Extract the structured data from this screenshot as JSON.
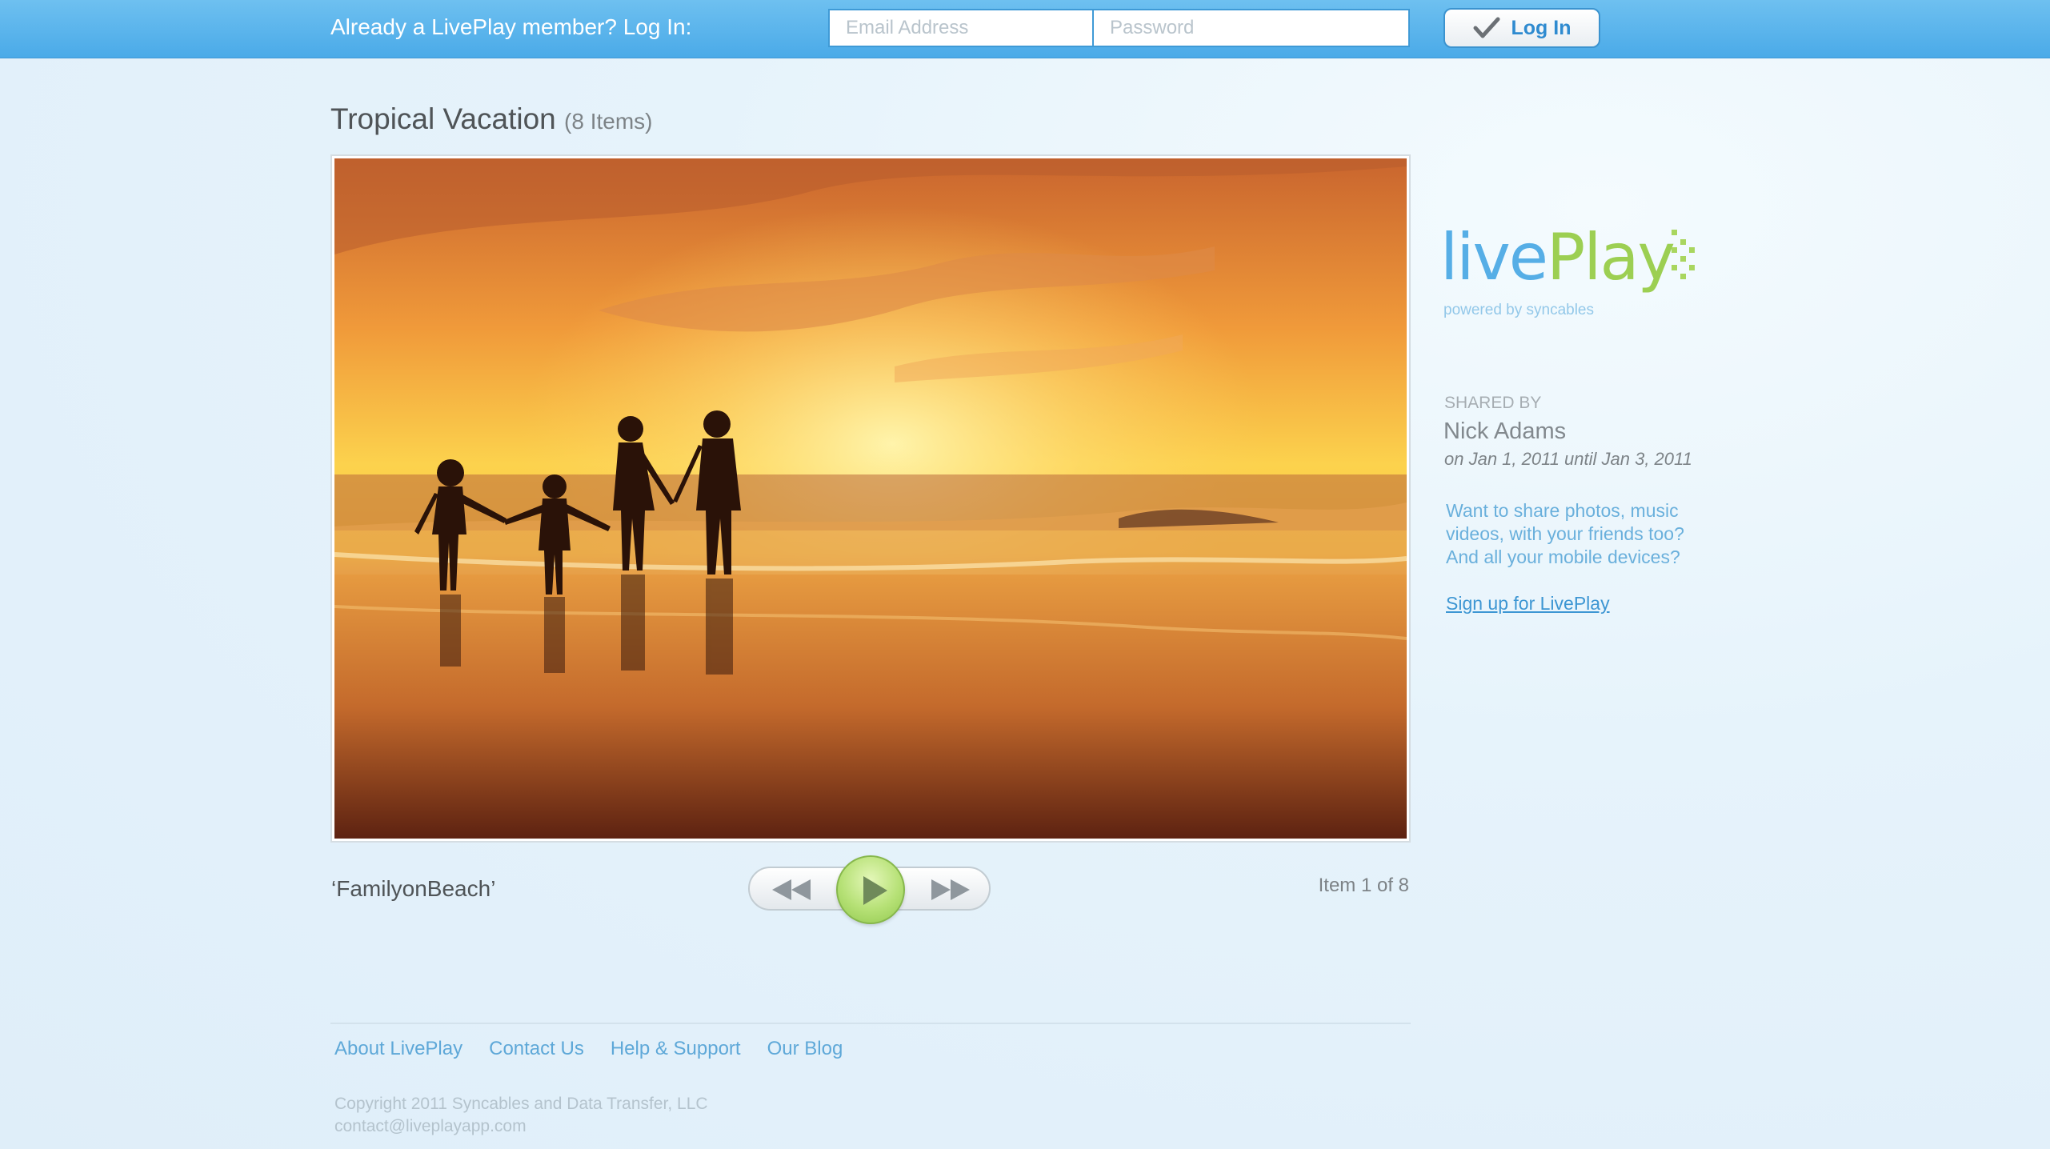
{
  "header": {
    "prompt": "Already a LivePlay member? Log In:",
    "email_placeholder": "Email Address",
    "password_placeholder": "Password",
    "login_label": "Log In"
  },
  "album": {
    "title": "Tropical Vacation",
    "count": "(8 Items)"
  },
  "item": {
    "caption": "‘FamilyonBeach’",
    "position": "Item 1 of 8"
  },
  "player": {
    "rewind_icon": "rewind-icon",
    "play_icon": "play-icon",
    "forward_icon": "fast-forward-icon"
  },
  "brand": {
    "live": "live",
    "play": "Play",
    "powered": "powered by syncables",
    "live_color": "#56aee6",
    "play_color": "#9ccf52"
  },
  "sidebar": {
    "shared_by_label": "SHARED BY",
    "shared_by_name": "Nick Adams",
    "dates": "on Jan 1, 2011 until Jan 3, 2011",
    "promo_line1": "Want to share photos, music",
    "promo_line2": "videos, with your friends too?",
    "promo_line3": "And all your mobile devices?",
    "signup_link": "Sign up for LivePlay"
  },
  "footer": {
    "links": [
      "About LivePlay",
      "Contact Us",
      "Help & Support",
      "Our Blog"
    ],
    "copyright": "Copyright 2011 Syncables and Data Transfer, LLC",
    "email": "contact@liveplayapp.com"
  }
}
